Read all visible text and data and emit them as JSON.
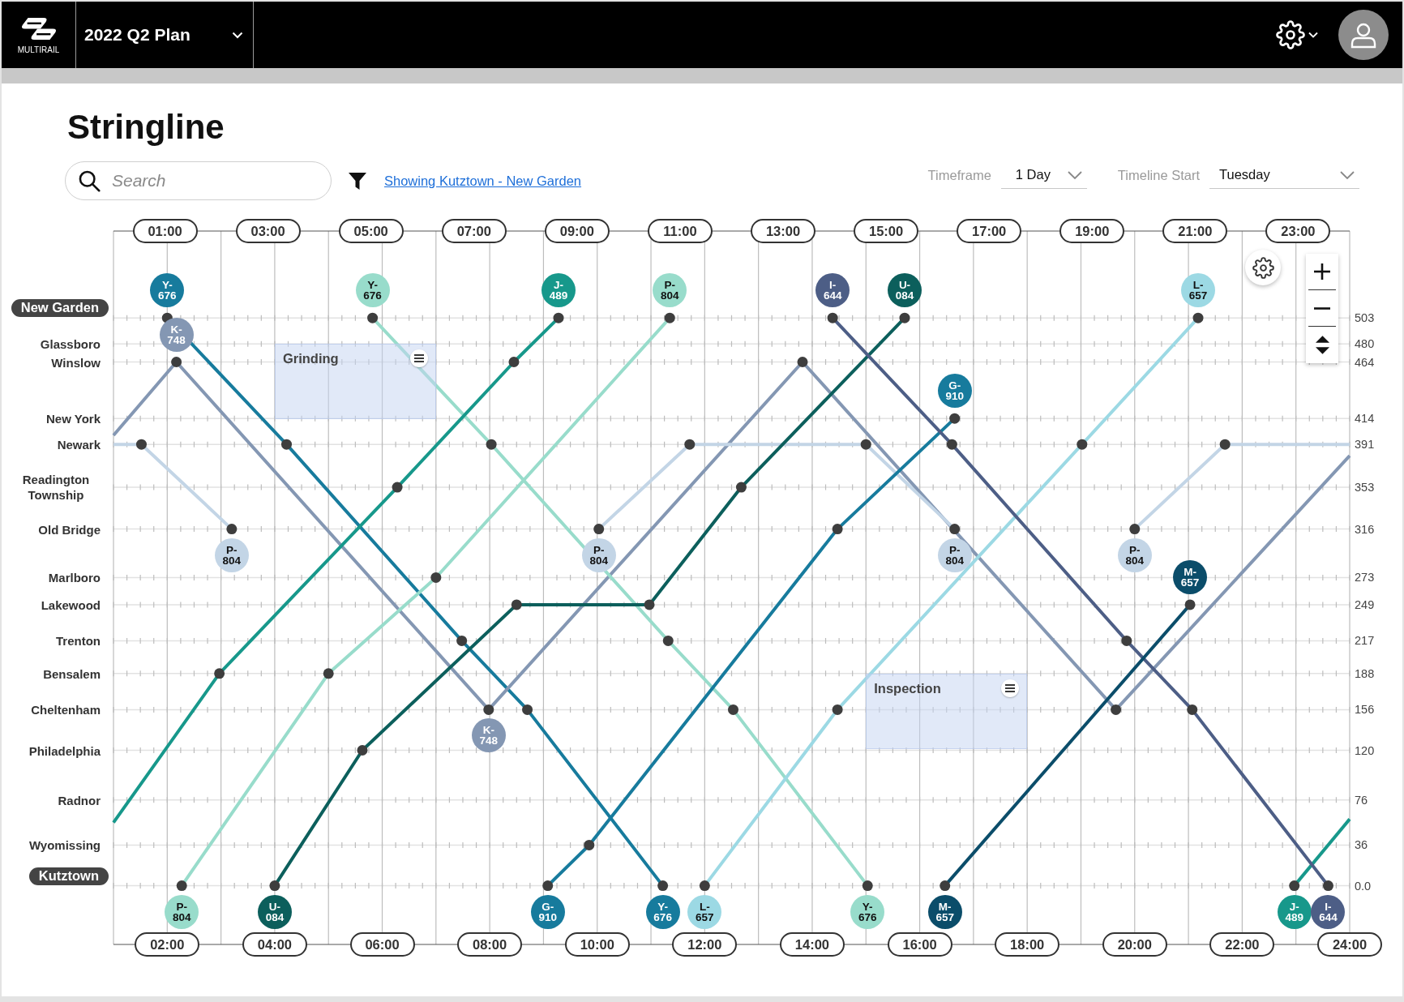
{
  "header": {
    "logo_text": "MULTIRAIL",
    "plan": "2022 Q2 Plan"
  },
  "page": {
    "title": "Stringline"
  },
  "search": {
    "placeholder": "Search"
  },
  "filter": {
    "link": "Showing Kutztown - New Garden"
  },
  "timeframe": {
    "label": "Timeframe",
    "value": "1 Day"
  },
  "timeline_start": {
    "label": "Timeline Start",
    "value": "Tuesday"
  },
  "stringline": {
    "stations": [
      {
        "name": "New Garden",
        "kind": "terminal"
      },
      {
        "name": "Glassboro",
        "kind": "station"
      },
      {
        "name": "Winslow",
        "kind": "station"
      },
      {
        "name": "New York",
        "kind": "station"
      },
      {
        "name": "Newark",
        "kind": "station"
      },
      {
        "name": "Readington Township",
        "kind": "station"
      },
      {
        "name": "Old Bridge",
        "kind": "station"
      },
      {
        "name": "Marlboro",
        "kind": "station"
      },
      {
        "name": "Lakewood",
        "kind": "station"
      },
      {
        "name": "Trenton",
        "kind": "station"
      },
      {
        "name": "Bensalem",
        "kind": "station"
      },
      {
        "name": "Cheltenham",
        "kind": "station"
      },
      {
        "name": "Philadelphia",
        "kind": "station"
      },
      {
        "name": "Radnor",
        "kind": "station"
      },
      {
        "name": "Wyomissing",
        "kind": "station"
      },
      {
        "name": "Kutztown",
        "kind": "terminal"
      }
    ],
    "top_axis": [
      "01:00",
      "03:00",
      "05:00",
      "07:00",
      "09:00",
      "11:00",
      "13:00",
      "15:00",
      "17:00",
      "19:00",
      "21:00",
      "23:00"
    ],
    "chart_data": {
      "type": "line",
      "grid": true,
      "xlim": [
        1,
        24
      ],
      "ylim": [
        -52,
        580
      ],
      "xticks": [
        {
          "value": 2,
          "label": "02:00"
        },
        {
          "value": 4,
          "label": "04:00"
        },
        {
          "value": 6,
          "label": "06:00"
        },
        {
          "value": 8,
          "label": "08:00"
        },
        {
          "value": 10,
          "label": "10:00"
        },
        {
          "value": 12,
          "label": "12:00"
        },
        {
          "value": 14,
          "label": "14:00"
        },
        {
          "value": 16,
          "label": "16:00"
        },
        {
          "value": 18,
          "label": "18:00"
        },
        {
          "value": 20,
          "label": "20:00"
        },
        {
          "value": 22,
          "label": "22:00"
        },
        {
          "value": 24,
          "label": "24:00"
        }
      ],
      "yticks": [
        {
          "value": 503,
          "label": "503"
        },
        {
          "value": 480,
          "label": "480"
        },
        {
          "value": 464,
          "label": "464"
        },
        {
          "value": 414,
          "label": "414"
        },
        {
          "value": 391,
          "label": "391"
        },
        {
          "value": 353,
          "label": "353"
        },
        {
          "value": 316,
          "label": "316"
        },
        {
          "value": 273,
          "label": "273"
        },
        {
          "value": 249,
          "label": "249"
        },
        {
          "value": 217,
          "label": "217"
        },
        {
          "value": 188,
          "label": "188"
        },
        {
          "value": 156,
          "label": "156"
        },
        {
          "value": 120,
          "label": "120"
        },
        {
          "value": 76,
          "label": "76"
        },
        {
          "value": 36,
          "label": "36"
        },
        {
          "value": 0,
          "label": "0.0"
        }
      ],
      "series": [
        {
          "color": "#177b9d",
          "marker": "circle",
          "x": [
            2,
            4.22,
            7.48,
            8.7,
            11.22
          ],
          "values": [
            503,
            391,
            217,
            156,
            0
          ]
        },
        {
          "color": "#8497b3",
          "marker": "circle",
          "x": [
            1,
            2.17,
            7.98,
            13.82,
            19.65,
            24
          ],
          "values": [
            399,
            464,
            156,
            464,
            156,
            381
          ]
        },
        {
          "color": "#c3d5e6",
          "marker": "circle",
          "x": [
            1,
            1.52,
            3.2
          ],
          "values": [
            391,
            391,
            316
          ]
        },
        {
          "color": "#c3d5e6",
          "marker": "circle",
          "x": [
            10.03,
            11.72,
            15,
            16.65
          ],
          "values": [
            316,
            391,
            391,
            316
          ]
        },
        {
          "color": "#c3d5e6",
          "marker": "circle",
          "x": [
            20,
            21.68,
            24
          ],
          "values": [
            316,
            391,
            391
          ]
        },
        {
          "color": "#98dccb",
          "marker": "circle",
          "x": [
            2.27,
            5,
            7,
            11.35
          ],
          "values": [
            0,
            188,
            273,
            503
          ]
        },
        {
          "color": "#98dccb",
          "marker": "circle",
          "x": [
            5.82,
            8.03,
            11.32,
            12.53,
            15.03
          ],
          "values": [
            503,
            391,
            217,
            156,
            0
          ]
        },
        {
          "color": "#17988b",
          "marker": "circle",
          "x": [
            1,
            2.97,
            6.28,
            8.45,
            9.28
          ],
          "values": [
            56,
            188,
            353,
            464,
            503
          ]
        },
        {
          "color": "#17988b",
          "marker": "circle",
          "x": [
            22.97,
            24
          ],
          "values": [
            0,
            59
          ]
        },
        {
          "color": "#0c5f5c",
          "marker": "circle",
          "x": [
            4,
            5.63,
            8.5,
            10.97,
            12.68,
            15.72
          ],
          "values": [
            0,
            120,
            249,
            249,
            353,
            503
          ]
        },
        {
          "color": "#177b9d",
          "marker": "circle",
          "x": [
            9.08,
            9.85,
            14.47,
            16.65
          ],
          "values": [
            0,
            36,
            316,
            414
          ]
        },
        {
          "color": "#9cd9e4",
          "marker": "circle",
          "x": [
            12,
            14.47,
            19.02,
            21.18
          ],
          "values": [
            0,
            156,
            391,
            503
          ]
        },
        {
          "color": "#4d5e86",
          "marker": "circle",
          "x": [
            14.38,
            16.6,
            19.85,
            21.07,
            23.6
          ],
          "values": [
            503,
            391,
            217,
            156,
            0
          ]
        },
        {
          "color": "#0b4d6a",
          "marker": "circle",
          "x": [
            16.47,
            21.03
          ],
          "values": [
            0,
            249
          ]
        }
      ],
      "annotations": [
        {
          "text": "Y-\n676",
          "x": 2,
          "y": 503
        },
        {
          "text": "K-\n748",
          "x": 2.17,
          "y": 464
        },
        {
          "text": "Y-\n676",
          "x": 5.82,
          "y": 503
        },
        {
          "text": "J-\n489",
          "x": 9.28,
          "y": 503
        },
        {
          "text": "P-\n804",
          "x": 11.35,
          "y": 503
        },
        {
          "text": "I-\n644",
          "x": 14.38,
          "y": 503
        },
        {
          "text": "U-\n084",
          "x": 15.72,
          "y": 503
        },
        {
          "text": "L-\n657",
          "x": 21.18,
          "y": 503
        },
        "Grinding",
        {
          "text": "G-\n910",
          "x": 16.65,
          "y": 414
        },
        {
          "text": "P-\n804",
          "x": 3.2,
          "y": 316
        },
        {
          "text": "P-\n804",
          "x": 10.03,
          "y": 316
        },
        {
          "text": "P-\n804",
          "x": 16.65,
          "y": 316
        },
        {
          "text": "P-\n804",
          "x": 20,
          "y": 316
        },
        {
          "text": "M-\n657",
          "x": 21.03,
          "y": 249
        },
        "Inspection",
        {
          "text": "K-\n748",
          "x": 7.98,
          "y": 156
        },
        {
          "text": "P-\n804",
          "x": 2.27,
          "y": 0
        },
        {
          "text": "U-\n084",
          "x": 4,
          "y": 0
        },
        {
          "text": "G-\n910",
          "x": 9.08,
          "y": 0
        },
        {
          "text": "Y-\n676",
          "x": 11.22,
          "y": 0
        },
        {
          "text": "L-\n657",
          "x": 12,
          "y": 0
        },
        {
          "text": "Y-\n676",
          "x": 15.03,
          "y": 0
        },
        {
          "text": "M-\n657",
          "x": 16.47,
          "y": 0
        },
        {
          "text": "J-\n489",
          "x": 22.97,
          "y": 0
        },
        {
          "text": "I-\n644",
          "x": 23.6,
          "y": 0
        }
      ]
    }
  }
}
